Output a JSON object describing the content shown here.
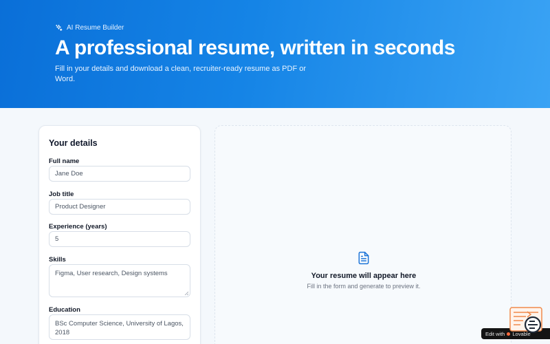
{
  "hero": {
    "badge": "AI Resume Builder",
    "title": "A professional resume, written in seconds",
    "subtitle": "Fill in your details and download a clean, recruiter-ready resume as PDF or Word."
  },
  "form": {
    "title": "Your details",
    "fields": [
      {
        "label": "Full name",
        "value": "Jane Doe"
      },
      {
        "label": "Job title",
        "value": "Product Designer"
      },
      {
        "label": "Experience (years)",
        "value": "5"
      },
      {
        "label": "Skills",
        "value": "Figma, User research, Design systems"
      },
      {
        "label": "Education",
        "value": "BSc Computer Science, University of Lagos, 2018"
      }
    ]
  },
  "preview": {
    "title": "Your resume will appear here",
    "subtitle": "Fill in the form and generate to preview it."
  },
  "badge_footer": {
    "prefix": "Edit with",
    "brand": "Lovable"
  },
  "colors": {
    "hero_start": "#0a6fd8",
    "hero_end": "#3aa3f4",
    "accent": "#1d74d8"
  },
  "icons": {
    "badge": "sparkles-icon",
    "preview": "document-icon"
  }
}
